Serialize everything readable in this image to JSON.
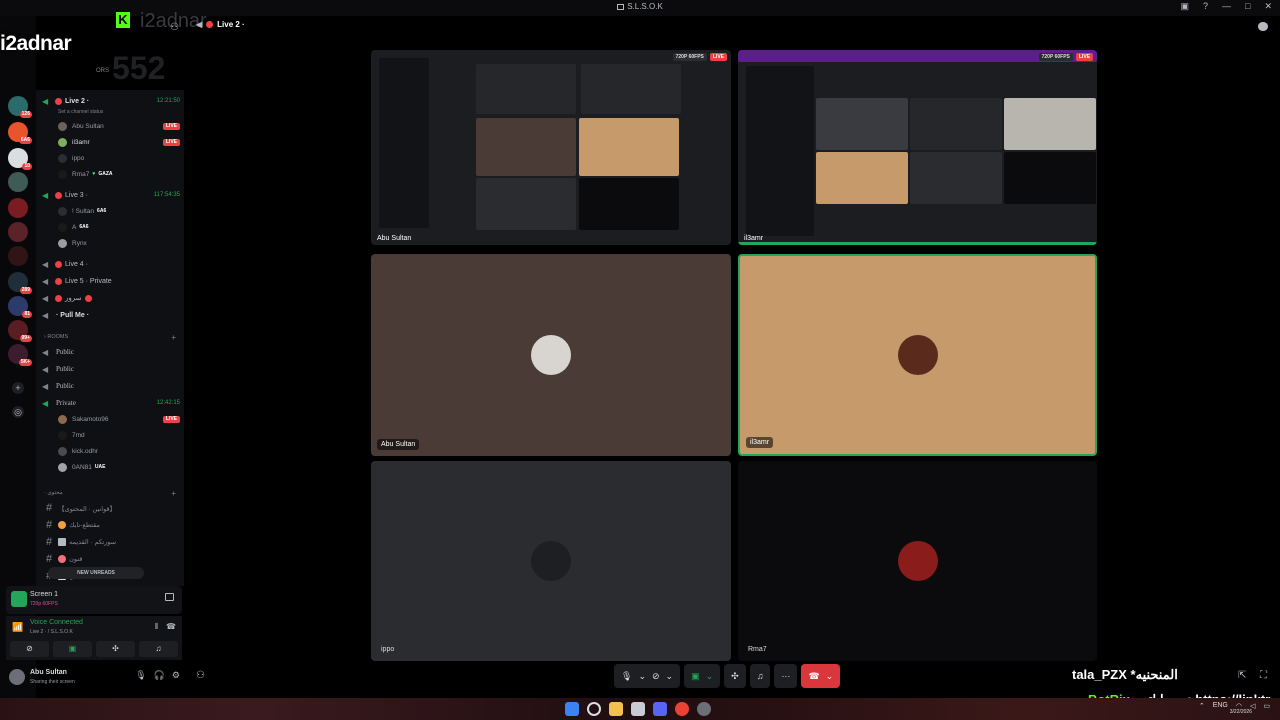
{
  "window": {
    "title": "S.L.S.O.K"
  },
  "overlay": {
    "channel_name": "i2adnar",
    "ghost_name": "i2adnar",
    "ghost_number": "552",
    "kick_letter": "K",
    "tala": "talа_PZX *المنحنيه",
    "botrix": "BotRix",
    "link": "حساباتي : https://linktr"
  },
  "rail": {
    "badges": [
      "126",
      "6A6",
      "10",
      "289",
      "81",
      "99+",
      "5K+"
    ]
  },
  "sidebar": {
    "header_label": "ORS",
    "channels": [
      {
        "name": "Live 2 ·",
        "time": "12:21:50",
        "status": "Set a channel status"
      },
      {
        "name": "Live 3 ·",
        "time": "117:54:35"
      },
      {
        "name": "Live 4 ·"
      },
      {
        "name": "Live 5 · Private"
      },
      {
        "name": "سرور"
      },
      {
        "name": "· Pull Me ·"
      }
    ],
    "live2_members": [
      {
        "name": "Abu Sultan",
        "live": "LIVE"
      },
      {
        "name": "il3amr",
        "live": "LIVE"
      },
      {
        "name": "ippo"
      },
      {
        "name": "Rma7",
        "tag": "GAZA"
      }
    ],
    "live3_members": [
      {
        "name": "! Sultan",
        "tag": "6A6"
      },
      {
        "name": "A",
        "tag": "6A6"
      },
      {
        "name": "Rynx"
      }
    ],
    "rooms_category": "ROOMS",
    "rooms": [
      {
        "name": "Public"
      },
      {
        "name": "Public"
      },
      {
        "name": "Public"
      },
      {
        "name": "Private",
        "time": "12:42:15"
      }
    ],
    "private_members": [
      {
        "name": "Sakamoto96",
        "live": "LIVE"
      },
      {
        "name": "7md"
      },
      {
        "name": "kick.odhr"
      },
      {
        "name": "0AN81",
        "tag": "UAE"
      }
    ],
    "text_category": "· محتوى",
    "text_channels": [
      {
        "name": "【قوانين · المحتوى】"
      },
      {
        "name": "مقتطع-نايك"
      },
      {
        "name": "سورتكم · القديمه"
      },
      {
        "name": "قنون"
      },
      {
        "name": "قن"
      }
    ],
    "new_unreads": "NEW UNREADS"
  },
  "screen_panel": {
    "title": "Screen 1",
    "quality": "720p 60FPS"
  },
  "voice_panel": {
    "status": "Voice Connected",
    "channel": "Live 2 · / S.L.S.O.K"
  },
  "user_panel": {
    "name": "Abu Sultan",
    "status": "Sharing their screen"
  },
  "call": {
    "title": "Live 2 ·"
  },
  "tiles": {
    "stream1": {
      "name": "Abu Sultan",
      "quality": "720P 60FPS",
      "live": "LIVE"
    },
    "stream2": {
      "name": "il3amr",
      "quality": "720P 60FPS",
      "live": "LIVE"
    },
    "t3": {
      "name": "Abu Sultan"
    },
    "t4": {
      "name": "il3amr"
    },
    "t5": {
      "name": "ippo"
    },
    "t6": {
      "name": "Rma7"
    }
  },
  "taskbar": {
    "date": "3/22/2026",
    "lang": "ENG"
  },
  "colors": {
    "accent_green": "#23a55a",
    "live_red": "#ed4245",
    "tile_brown": "#4a3b37",
    "tile_tan": "#c69a6a",
    "tile_gray": "#2b2c30"
  }
}
